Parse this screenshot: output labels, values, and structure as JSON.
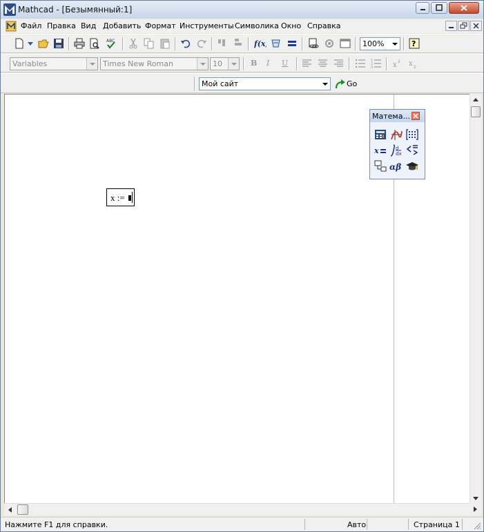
{
  "window": {
    "title": "Mathcad - [Безымянный:1]"
  },
  "menu": {
    "items": [
      {
        "label": "Файл"
      },
      {
        "label": "Правка"
      },
      {
        "label": "Вид"
      },
      {
        "label": "Добавить"
      },
      {
        "label": "Формат"
      },
      {
        "label": "Инструменты"
      },
      {
        "label": "Символика"
      },
      {
        "label": "Окно"
      },
      {
        "label": "Справка"
      }
    ]
  },
  "standard_toolbar": {
    "zoom_value": "100%"
  },
  "formatting_toolbar": {
    "style_value": "Variables",
    "font_value": "Times New Roman",
    "size_value": "10",
    "bold_label": "B",
    "italic_label": "I",
    "underline_label": "U"
  },
  "resources_toolbar": {
    "site_value": "Мой сайт",
    "go_label": "Go"
  },
  "math_palette": {
    "title": "Матема..."
  },
  "worksheet": {
    "expression": "x :="
  },
  "status_bar": {
    "help_text": "Нажмите F1 для справки.",
    "mode": "Авто",
    "page": "Страница 1"
  },
  "colors": {
    "title_gradient_top": "#e4ecf7",
    "close_button": "#c4472c",
    "palette_border": "#6d8fbf"
  }
}
